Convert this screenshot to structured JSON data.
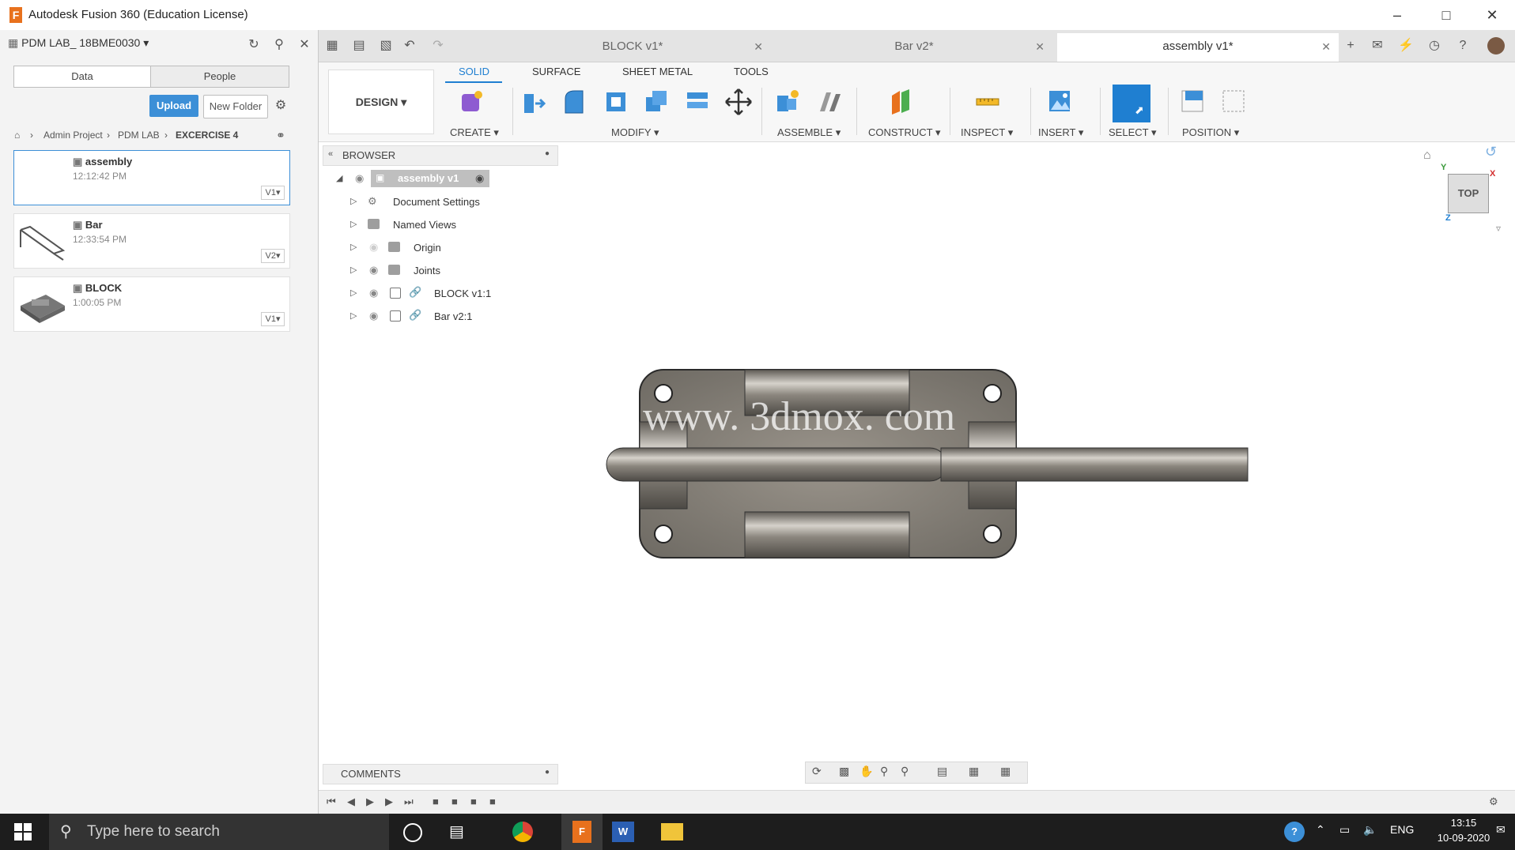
{
  "window": {
    "title": "Autodesk Fusion 360 (Education License)"
  },
  "left_panel": {
    "project": "PDM LAB_ 18BME0030",
    "tabs": [
      "Data",
      "People"
    ],
    "upload_label": "Upload",
    "new_folder_label": "New Folder",
    "breadcrumb": [
      "Admin Project",
      "PDM LAB",
      "EXCERCISE 4"
    ],
    "files": [
      {
        "name": "assembly",
        "time": "12:12:42 PM",
        "version": "V1"
      },
      {
        "name": "Bar",
        "time": "12:33:54 PM",
        "version": "V2"
      },
      {
        "name": "BLOCK",
        "time": "1:00:05 PM",
        "version": "V1"
      }
    ]
  },
  "doc_tabs": [
    {
      "label": "BLOCK v1*"
    },
    {
      "label": "Bar v2*"
    },
    {
      "label": "assembly v1*"
    }
  ],
  "ribbon": {
    "workspace": "DESIGN",
    "tabs": [
      "SOLID",
      "SURFACE",
      "SHEET METAL",
      "TOOLS"
    ],
    "groups": [
      "CREATE",
      "MODIFY",
      "ASSEMBLE",
      "CONSTRUCT",
      "INSPECT",
      "INSERT",
      "SELECT",
      "POSITION"
    ]
  },
  "browser": {
    "title": "BROWSER",
    "root": "assembly v1",
    "items": [
      "Document Settings",
      "Named Views",
      "Origin",
      "Joints",
      "BLOCK v1:1",
      "Bar v2:1"
    ]
  },
  "comments_label": "COMMENTS",
  "viewcube": {
    "face": "TOP",
    "axis_x": "X",
    "axis_y": "Y",
    "axis_z": "Z"
  },
  "watermark": "www. 3dmox. com",
  "taskbar": {
    "search_placeholder": "Type here to search",
    "lang": "ENG",
    "time": "13:15",
    "date": "10-09-2020"
  },
  "colors": {
    "accent": "#1f7fd1",
    "upload": "#3c8fd7",
    "model": "#8a847a"
  }
}
